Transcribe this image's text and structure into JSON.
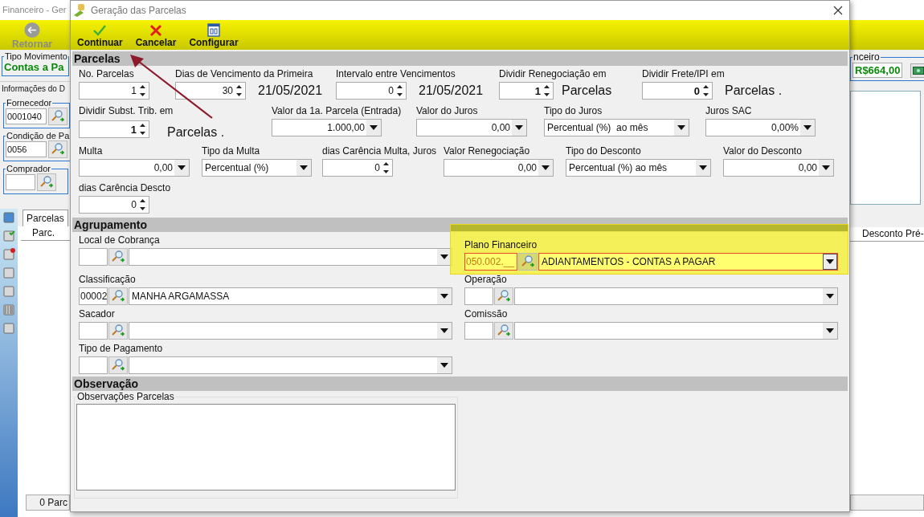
{
  "background_window": {
    "title": "Financeiro - Ger",
    "toolbar": [
      {
        "label": "Retornar",
        "disabled": true
      }
    ],
    "tipo_movimento": {
      "legend": "Tipo Movimento",
      "value": "Contas a Pa"
    },
    "info_tab": "Informações do D",
    "groups": [
      {
        "legend": "Fornecedor",
        "code": "0001040"
      },
      {
        "legend": "Condição de Pa",
        "code": "0056"
      },
      {
        "legend": "Comprador"
      }
    ],
    "tabs": [
      {
        "label": "Parcelas",
        "selected": true
      }
    ],
    "grid_columns": [
      "Parc.",
      "Desconto Pré-"
    ],
    "footer": "0 Parc",
    "financeiro": {
      "legend": "nceiro",
      "value": "R$664,00"
    }
  },
  "dialog": {
    "title": "Geração das Parcelas",
    "toolbar": [
      {
        "label": "Continuar",
        "kind": "ok"
      },
      {
        "label": "Cancelar",
        "kind": "cancel"
      },
      {
        "label": "Configurar",
        "kind": "config"
      }
    ],
    "parcelas": {
      "title": "Parcelas",
      "rows": [
        {
          "fields": [
            {
              "kind": "spin",
              "label": "No. Parcelas",
              "value": "1",
              "bold": false
            },
            {
              "kind": "spin",
              "label": "Dias de Vencimento da Primeira",
              "value": "30",
              "bold": false,
              "suffix": "21/05/2021"
            },
            {
              "kind": "spin",
              "label": "Intervalo entre Vencimentos",
              "value": "0",
              "bold": false,
              "suffix": "21/05/2021"
            },
            {
              "kind": "spin",
              "label": "Dividir Renegociação em",
              "value": "1",
              "bold": true,
              "suffix": "Parcelas"
            },
            {
              "kind": "spin",
              "label": "Dividir Frete/IPI em",
              "value": "0",
              "bold": true,
              "suffix": "Parcelas ."
            }
          ]
        },
        {
          "fields": [
            {
              "kind": "spin",
              "label": "Dividir Subst. Trib. em",
              "value": "1",
              "bold": true,
              "suffix": "Parcelas ."
            },
            {
              "kind": "amount",
              "label": "Valor da 1a. Parcela (Entrada)",
              "value": "1.000,00"
            },
            {
              "kind": "amount",
              "label": "Valor do Juros",
              "value": "0,00"
            },
            {
              "kind": "select",
              "label": "Tipo do Juros",
              "value": "Percentual (%)  ao mês"
            },
            {
              "kind": "amount",
              "label": "Juros SAC",
              "value": "0,00%"
            }
          ]
        },
        {
          "fields": [
            {
              "kind": "amount",
              "label": "Multa",
              "value": "0,00"
            },
            {
              "kind": "select",
              "label": "Tipo da Multa",
              "value": "Percentual (%)"
            },
            {
              "kind": "spin",
              "label": "dias Carência Multa, Juros",
              "value": "0",
              "bold": false
            },
            {
              "kind": "amount",
              "label": "Valor Renegociação",
              "value": "0,00"
            },
            {
              "kind": "select",
              "label": "Tipo do Desconto",
              "value": "Percentual (%) ao mês"
            },
            {
              "kind": "amount",
              "label": "Valor do Desconto",
              "value": "0,00"
            }
          ]
        },
        {
          "fields": [
            {
              "kind": "spin",
              "label": "dias Carência Descto",
              "value": "0",
              "bold": false
            }
          ]
        }
      ]
    },
    "agrupamento": {
      "title": "Agrupamento",
      "lookups": [
        {
          "label": "Local de Cobrança",
          "highlighted": false
        },
        {
          "label": "Plano Financeiro",
          "code": "050.002.__",
          "value": "ADIANTAMENTOS - CONTAS A PAGAR",
          "highlighted": true
        },
        {
          "label": "Classificação",
          "code": "00002",
          "value": "MANHA ARGAMASSA",
          "highlighted": false
        },
        {
          "label": "Operação",
          "highlighted": false
        },
        {
          "label": "Sacador",
          "highlighted": false
        },
        {
          "label": "Comissão",
          "highlighted": false
        },
        {
          "label": "Tipo de Pagamento",
          "highlighted": false
        }
      ]
    },
    "observacao": {
      "title": "Observação",
      "group": "Observações Parcelas"
    }
  }
}
